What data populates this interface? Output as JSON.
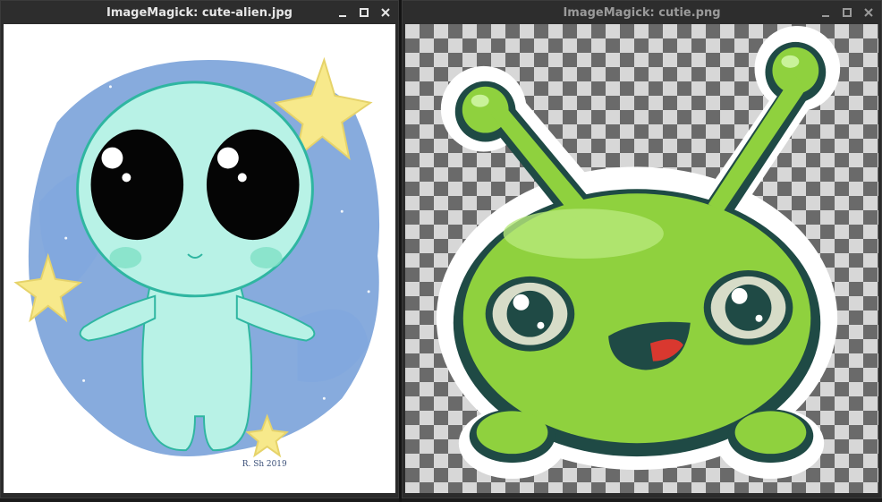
{
  "windows": [
    {
      "title": "ImageMagick: cute-alien.jpg",
      "active": true,
      "controls": [
        "minimize-icon",
        "maximize-icon",
        "close-icon"
      ],
      "image_signature": "R. Sh 2019"
    },
    {
      "title": "ImageMagick: cutie.png",
      "active": false,
      "controls": [
        "minimize-icon",
        "maximize-icon",
        "close-icon"
      ]
    }
  ],
  "colors": {
    "titlebar_bg": "#2d2d2d",
    "title_active": "#e6e6e6",
    "title_inactive": "#9a9a9a",
    "alien_skin": "#b8f2e6",
    "alien_outline": "#2fb6a1",
    "sky_blue": "#5f8fd1",
    "star_yellow": "#f7e98b",
    "green_body": "#8fd13e",
    "dark_outline": "#1f4a45"
  }
}
